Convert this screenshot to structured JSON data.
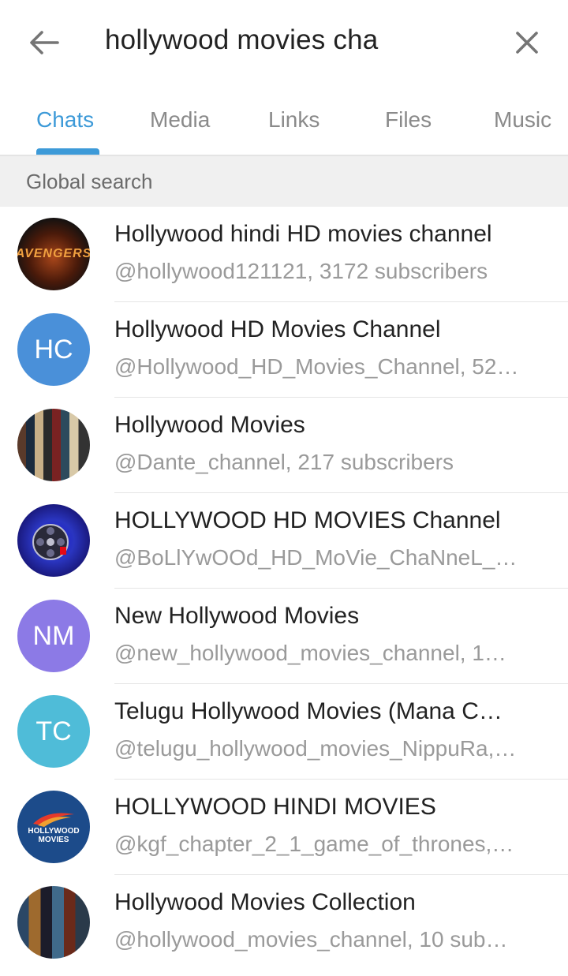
{
  "search": {
    "query": "hollywood movies cha"
  },
  "icons": {
    "back": "arrow-left-icon",
    "close": "close-icon"
  },
  "tabs": [
    {
      "label": "Chats",
      "active": true
    },
    {
      "label": "Media",
      "active": false
    },
    {
      "label": "Links",
      "active": false
    },
    {
      "label": "Files",
      "active": false
    },
    {
      "label": "Music",
      "active": false
    }
  ],
  "section": {
    "title": "Global search"
  },
  "results": [
    {
      "title": "Hollywood hindi HD movies channel",
      "subtitle": "@hollywood121121, 3172 subscribers",
      "avatar": {
        "type": "image",
        "logo_text": "AVENGERS"
      }
    },
    {
      "title": "Hollywood HD Movies Channel",
      "subtitle": "@Hollywood_HD_Movies_Channel, 52…",
      "avatar": {
        "type": "initials",
        "initials": "HC",
        "color": "#4a90d9"
      }
    },
    {
      "title": "Hollywood Movies",
      "subtitle": "@Dante_channel, 217 subscribers",
      "avatar": {
        "type": "image"
      }
    },
    {
      "title": "HOLLYWOOD HD MOVIES Channel",
      "subtitle": "@BoLlYwOOd_HD_MoVie_ChaNneL_…",
      "avatar": {
        "type": "image"
      }
    },
    {
      "title": "New Hollywood Movies",
      "subtitle": "@new_hollywood_movies_channel, 1…",
      "avatar": {
        "type": "initials",
        "initials": "NM",
        "color": "#8c7ae6"
      }
    },
    {
      "title": "Telugu Hollywood Movies (Mana C…",
      "subtitle": "@telugu_hollywood_movies_NippuRa,…",
      "avatar": {
        "type": "initials",
        "initials": "TC",
        "color": "#4fbcd8"
      }
    },
    {
      "title": "HOLLYWOOD HINDI MOVIES",
      "subtitle": "@kgf_chapter_2_1_game_of_thrones,…",
      "avatar": {
        "type": "image",
        "logo_text": "HOLLYWOOD MOVIES"
      }
    },
    {
      "title": "Hollywood Movies Collection",
      "subtitle": "@hollywood_movies_channel, 10 sub…",
      "avatar": {
        "type": "image"
      }
    }
  ],
  "colors": {
    "accent": "#3d9ad8",
    "section_bg": "#f0f0f0"
  }
}
